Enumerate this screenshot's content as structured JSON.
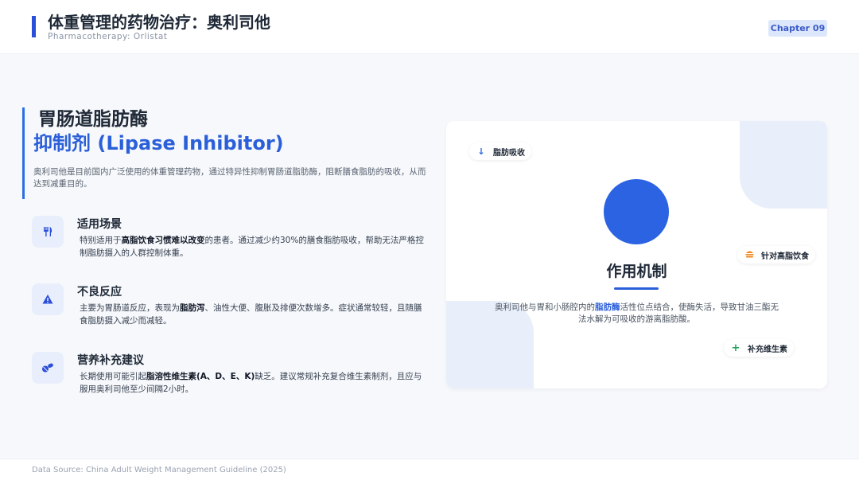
{
  "header": {
    "title": "体重管理的药物治疗：奥利司他",
    "subtitle": "Pharmacotherapy: Orlistat",
    "chapter": "Chapter 09"
  },
  "hero": {
    "title_line1": "胃肠道脂肪酶",
    "title_line2": "抑制剂 (Lipase Inhibitor)",
    "description": "奥利司他是目前国内广泛使用的体重管理药物，通过特异性抑制胃肠道脂肪酶，阻断膳食脂肪的吸收，从而达到减重目的。"
  },
  "features": [
    {
      "icon": "utensils-icon",
      "title": "适用场景",
      "desc_pre": "特别适用于",
      "desc_bold": "高脂饮食习惯难以改变",
      "desc_post": "的患者。通过减少约30%的膳食脂肪吸收，帮助无法严格控制脂肪摄入的人群控制体重。"
    },
    {
      "icon": "warning-icon",
      "title": "不良反应",
      "desc_pre": "主要为胃肠道反应，表现为",
      "desc_bold": "脂肪泻",
      "desc_post": "、油性大便、腹胀及排便次数增多。症状通常较轻，且随膳食脂肪摄入减少而减轻。"
    },
    {
      "icon": "pills-icon",
      "title": "营养补充建议",
      "desc_pre": "长期使用可能引起",
      "desc_bold": "脂溶性维生素(A、D、E、K)",
      "desc_post": "缺乏。建议常规补充复合维生素制剂，且应与服用奥利司他至少间隔2小时。"
    }
  ],
  "mechanism": {
    "title": "作用机制",
    "desc_pre": "奥利司他与胃和小肠腔内的",
    "desc_bold": "脂肪酶",
    "desc_post": "活性位点结合，使酶失活，导致甘油三酯无法水解为可吸收的游离脂肪酸。",
    "tags": [
      {
        "icon": "arrow-down-icon",
        "label": "脂肪吸收",
        "color": "#2b63e3"
      },
      {
        "icon": "burger-icon",
        "label": "针对高脂饮食",
        "color": "#f08a24"
      },
      {
        "icon": "plus-icon",
        "label": "补充维生素",
        "color": "#22a35a"
      }
    ]
  },
  "footer": {
    "source": "Data Source: China Adult Weight Management Guideline (2025)"
  }
}
